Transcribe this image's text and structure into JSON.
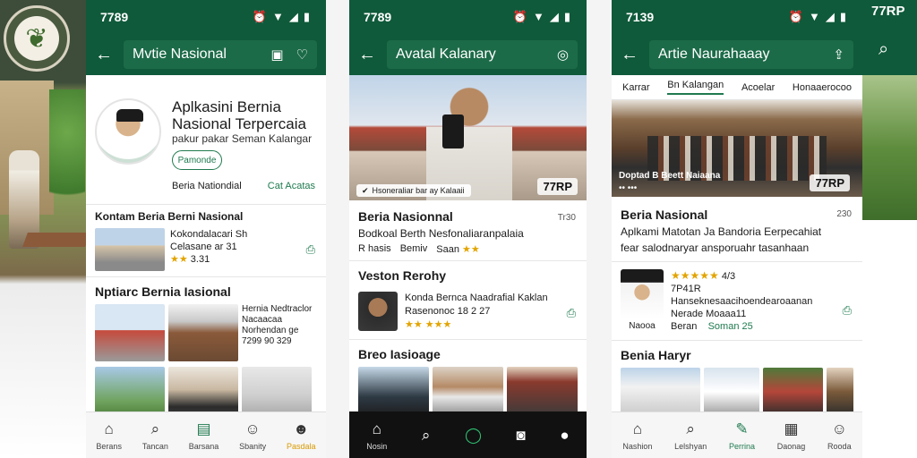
{
  "brand_corner": {
    "label": "77RP"
  },
  "phone1": {
    "status_time": "7789",
    "search_text": "Mvtie Nasional",
    "profile": {
      "title": "Aplkasini Bernia Nasional Terpercaia",
      "subtitle": "pakur pakar Seman Kalangar",
      "follow_label": "Pamonde",
      "meta_left": "Beria Nationdial",
      "meta_right": "Cat Acatas"
    },
    "section1_title": "Kontam Beria Berni Nasional",
    "news1": {
      "line1": "Kokondalacari Sh",
      "line2": "Celasane ar 31",
      "stars": "★★",
      "rating": "3.31"
    },
    "section2_title": "Nptiarc Bernia Iasional",
    "grid_caption": {
      "line1": "Hernia Nedtraclor",
      "line2": "Nacaacaa",
      "line3": "Norhendan ge",
      "line4": "7299 90 329"
    },
    "nav": [
      "Berans",
      "Tancan",
      "Barsana",
      "Sbanity",
      "Pasdala"
    ]
  },
  "phone2": {
    "status_time": "7789",
    "search_text": "Avatal Kalanary",
    "hero_caption": "Hsoneraliar bar ay Kalaaii",
    "hero_badge": "77RP",
    "headline": "Beria Nasionnal",
    "headline_time": "Tr30",
    "headline_sub": "Bodkoal Berth Nesfonaliaranpalaia",
    "headline_meta": {
      "left": "R hasis",
      "mid": "Bemiv",
      "right": "Saan",
      "stars": "★★"
    },
    "section_title": "Veston Rerohy",
    "card": {
      "title": "Konda Bernca Naadrafial Kaklan",
      "meta": "Rasenonoc 18 2 27",
      "stars": "★★ ★★★"
    },
    "section2_title": "Breo Iasioage",
    "nav": [
      "Nosin"
    ]
  },
  "phone3": {
    "status_time": "7139",
    "search_text": "Artie Naurahaaay",
    "tabs": [
      "Karrar",
      "Bn Kalangan",
      "Acoelar",
      "Honaaerocoo"
    ],
    "hero_caption": "Doptad B Beett Naiaana",
    "hero_badge": "77RP",
    "hero_dots": "•• •••",
    "title": "Beria Nasional",
    "time": "230",
    "sub1": "Aplkami Matotan Ja Bandoria Eerpecahiat",
    "sub2": "fear salodnaryar ansporuahr tasanhaan",
    "profile_card": {
      "avatar_label": "Naooa",
      "stars": "★★★★★",
      "rating": "4/3",
      "line1": "7P41R",
      "line2": "Hanseknesaacihoendearoaanan",
      "line3": "Nerade Moaaa11",
      "line4a": "Beran",
      "line4b": "Soman 25"
    },
    "section_title": "Benia Haryr",
    "nav": [
      "Nashion",
      "Lelshyan",
      "Perrina",
      "Daonag",
      "Rooda"
    ]
  }
}
